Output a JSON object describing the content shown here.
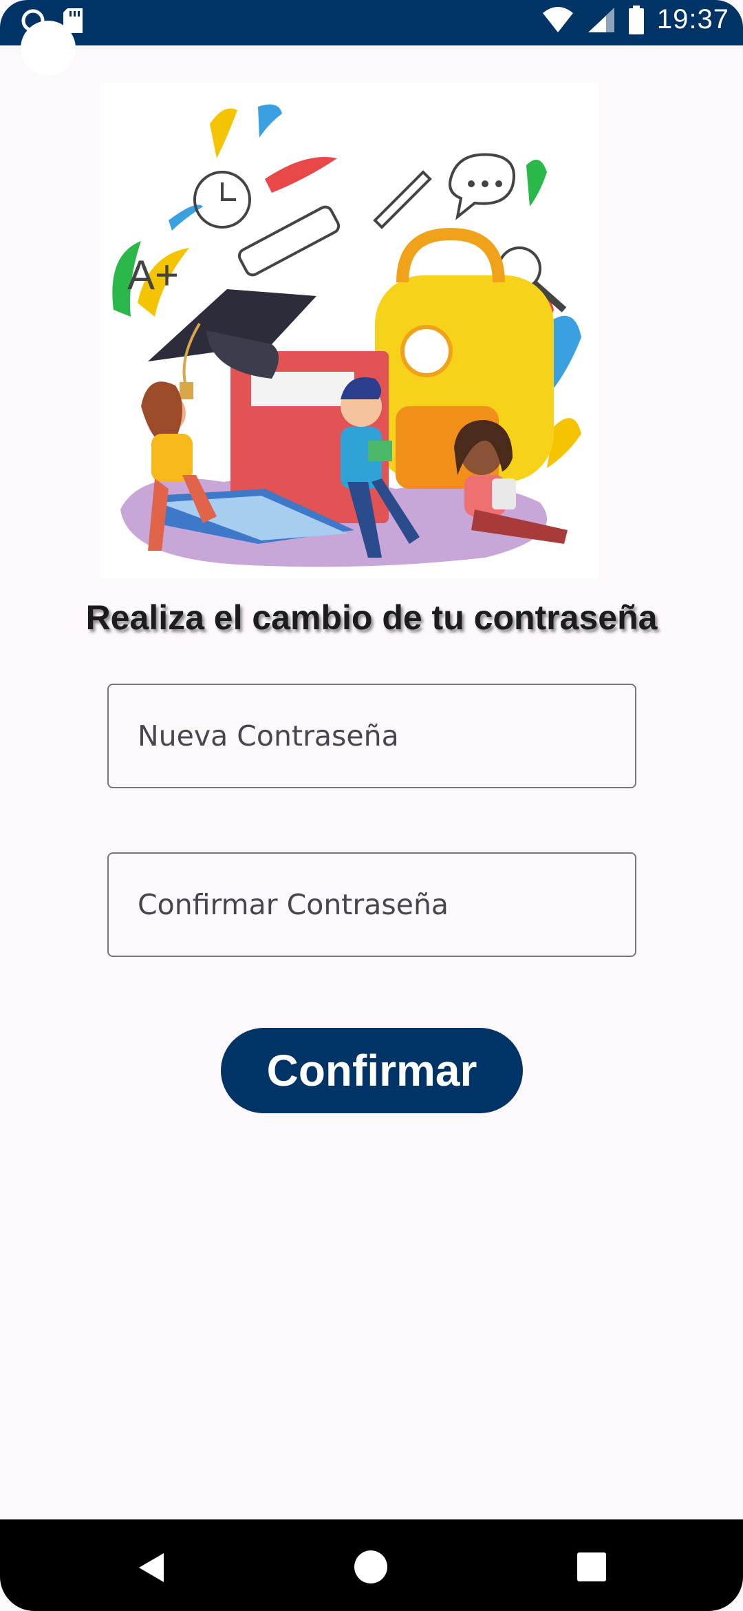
{
  "status_bar": {
    "time": "19:37"
  },
  "page": {
    "title": "Realiza el cambio de tu contraseña",
    "new_password_placeholder": "Nueva Contraseña",
    "confirm_password_placeholder": "Confirmar Contraseña",
    "confirm_button_label": "Confirmar"
  },
  "colors": {
    "primary": "#003366",
    "background": "#fdf8fc",
    "field_border": "#79747e"
  },
  "icons": {
    "status_left": [
      "circle-notification-icon",
      "sd-card-icon"
    ],
    "status_right": [
      "wifi-icon",
      "signal-icon",
      "battery-icon"
    ],
    "nav": [
      "back-icon",
      "home-icon",
      "recents-icon"
    ]
  }
}
